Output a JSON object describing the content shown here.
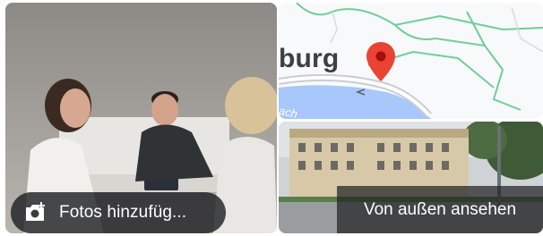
{
  "photo_tile": {
    "add_photos_label": "Fotos hinzufüg...",
    "camera_icon": "add-photo-icon"
  },
  "map_tile": {
    "city_label": "burg",
    "water_label": "ach",
    "pin_icon": "map-pin-icon",
    "colors": {
      "road": "#6fcf97",
      "water": "#a8c7fa",
      "pin": "#ea4335"
    }
  },
  "street_tile": {
    "label": "Von außen ansehen"
  }
}
